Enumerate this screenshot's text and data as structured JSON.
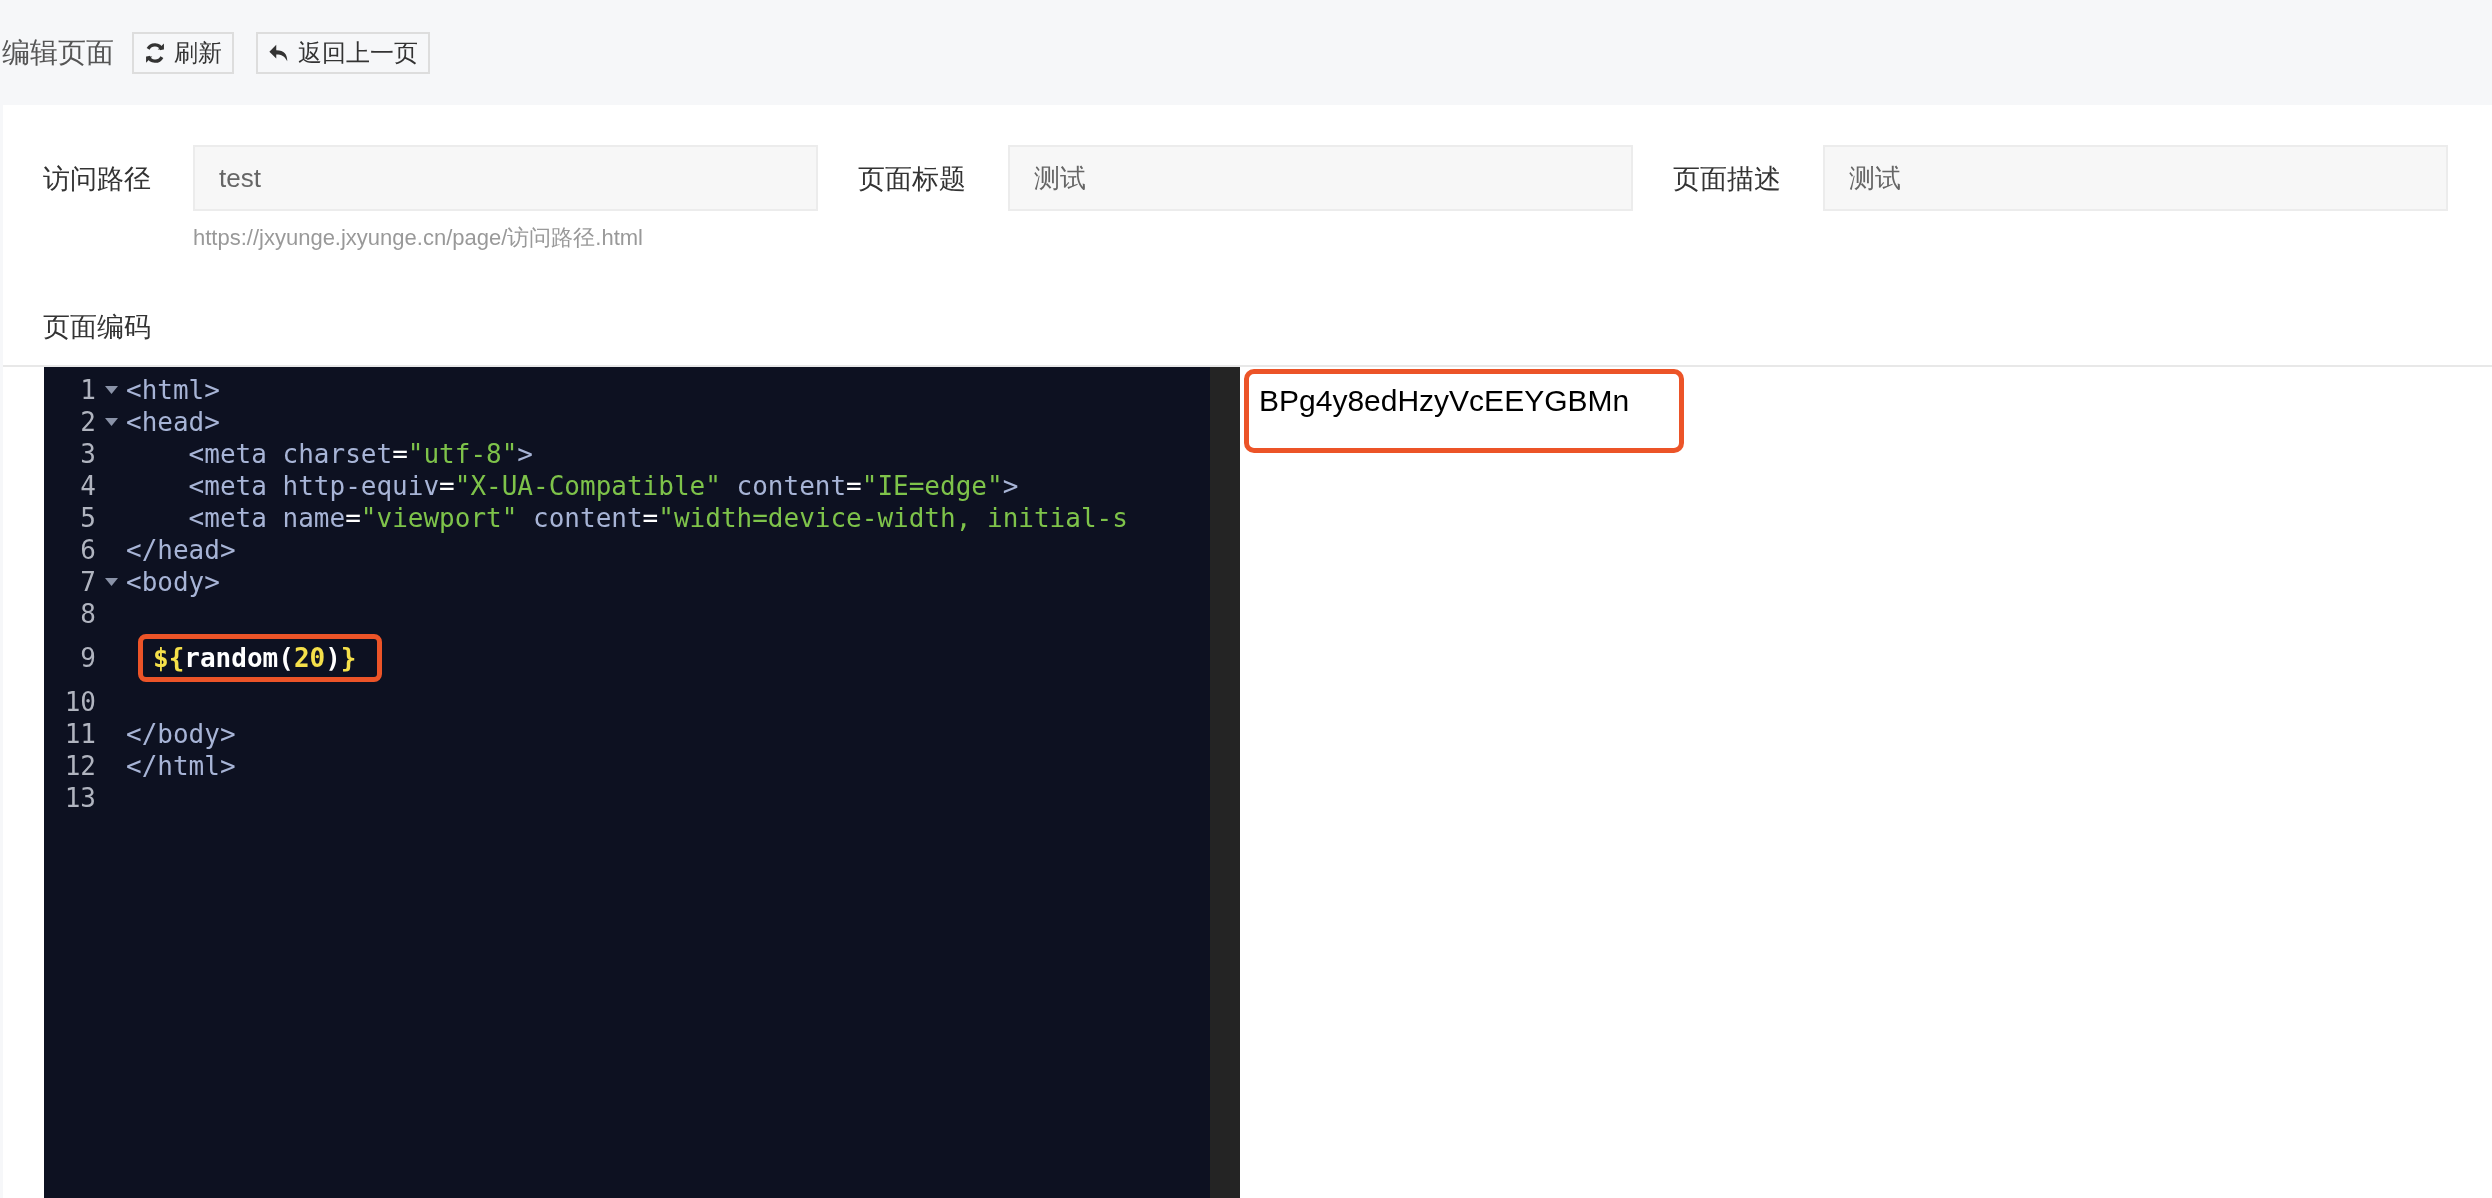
{
  "header": {
    "title": "编辑页面",
    "buttons": [
      {
        "kind": "refresh",
        "label": "刷新"
      },
      {
        "kind": "back",
        "label": "返回上一页"
      }
    ]
  },
  "form": {
    "fields": [
      {
        "label": "访问路径",
        "value": "test",
        "hint": "https://jxyunge.jxyunge.cn/page/访问路径.html"
      },
      {
        "label": "页面标题",
        "value": "测试"
      },
      {
        "label": "页面描述",
        "value": "测试"
      }
    ],
    "code_label": "页面编码"
  },
  "editor": {
    "lines": [
      {
        "number": "1",
        "foldable": true,
        "annotated": false,
        "tokens": [
          {
            "kind": "tag",
            "text": "<html>"
          }
        ]
      },
      {
        "number": "2",
        "foldable": true,
        "annotated": false,
        "tokens": [
          {
            "kind": "tag",
            "text": "<head>"
          }
        ]
      },
      {
        "number": "3",
        "foldable": false,
        "annotated": false,
        "tokens": [
          {
            "kind": "tag",
            "text": "    <meta "
          },
          {
            "kind": "attr",
            "text": "charset"
          },
          {
            "kind": "plain",
            "text": "="
          },
          {
            "kind": "string",
            "text": "\"utf-8\""
          },
          {
            "kind": "tag",
            "text": ">"
          }
        ]
      },
      {
        "number": "4",
        "foldable": false,
        "annotated": false,
        "tokens": [
          {
            "kind": "tag",
            "text": "    <meta "
          },
          {
            "kind": "attr",
            "text": "http-equiv"
          },
          {
            "kind": "plain",
            "text": "="
          },
          {
            "kind": "string",
            "text": "\"X-UA-Compatible\""
          },
          {
            "kind": "attr",
            "text": " content"
          },
          {
            "kind": "plain",
            "text": "="
          },
          {
            "kind": "string",
            "text": "\"IE=edge\""
          },
          {
            "kind": "tag",
            "text": ">"
          }
        ]
      },
      {
        "number": "5",
        "foldable": false,
        "annotated": false,
        "tokens": [
          {
            "kind": "tag",
            "text": "    <meta "
          },
          {
            "kind": "attr",
            "text": "name"
          },
          {
            "kind": "plain",
            "text": "="
          },
          {
            "kind": "string",
            "text": "\"viewport\""
          },
          {
            "kind": "attr",
            "text": " content"
          },
          {
            "kind": "plain",
            "text": "="
          },
          {
            "kind": "string",
            "text": "\"width=device-width, initial-s"
          }
        ]
      },
      {
        "number": "6",
        "foldable": false,
        "annotated": false,
        "tokens": [
          {
            "kind": "tag",
            "text": "</head>"
          }
        ]
      },
      {
        "number": "7",
        "foldable": true,
        "annotated": false,
        "tokens": [
          {
            "kind": "tag",
            "text": "<body>"
          }
        ]
      },
      {
        "number": "8",
        "foldable": false,
        "annotated": false
      },
      {
        "number": "9",
        "foldable": false,
        "annotated": true,
        "tokens": [
          {
            "kind": "keyword",
            "text": "${"
          },
          {
            "kind": "plain",
            "text": "random("
          },
          {
            "kind": "keyword",
            "text": "20"
          },
          {
            "kind": "plain",
            "text": ")"
          },
          {
            "kind": "keyword",
            "text": "}"
          }
        ]
      },
      {
        "number": "10",
        "foldable": false,
        "annotated": false
      },
      {
        "number": "11",
        "foldable": false,
        "annotated": false,
        "tokens": [
          {
            "kind": "tag",
            "text": "</body>"
          }
        ]
      },
      {
        "number": "12",
        "foldable": false,
        "annotated": false,
        "tokens": [
          {
            "kind": "tag",
            "text": "</html>"
          }
        ]
      },
      {
        "number": "13",
        "foldable": false,
        "annotated": false
      }
    ]
  },
  "preview": {
    "text": "BPg4y8edHzyVcEEYGBMn",
    "annotated": true
  }
}
